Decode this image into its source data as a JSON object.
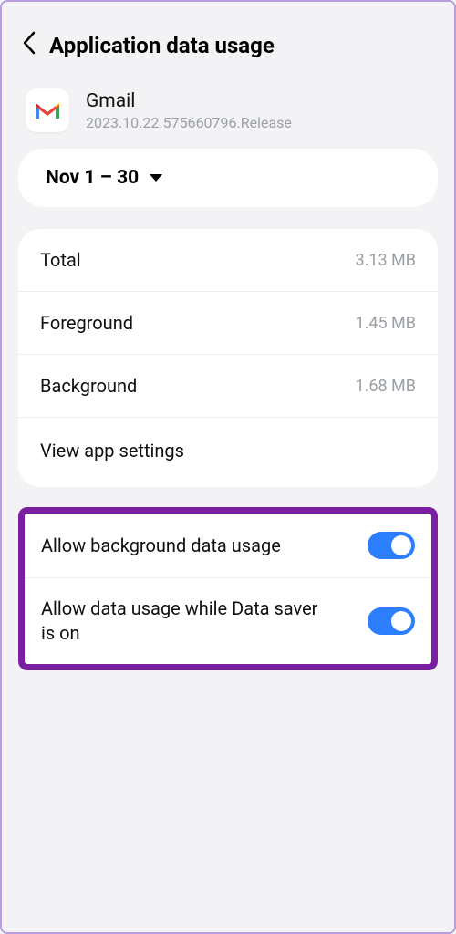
{
  "header": {
    "title": "Application data usage"
  },
  "app": {
    "name": "Gmail",
    "version": "2023.10.22.575660796.Release"
  },
  "dateRange": {
    "label": "Nov 1 – 30"
  },
  "stats": {
    "total": {
      "label": "Total",
      "value": "3.13 MB"
    },
    "foreground": {
      "label": "Foreground",
      "value": "1.45 MB"
    },
    "background": {
      "label": "Background",
      "value": "1.68 MB"
    },
    "viewSettings": "View app settings"
  },
  "toggles": {
    "bgData": {
      "label": "Allow background data usage",
      "on": true
    },
    "dataSaver": {
      "label": "Allow data usage while Data saver is on",
      "on": true
    }
  }
}
